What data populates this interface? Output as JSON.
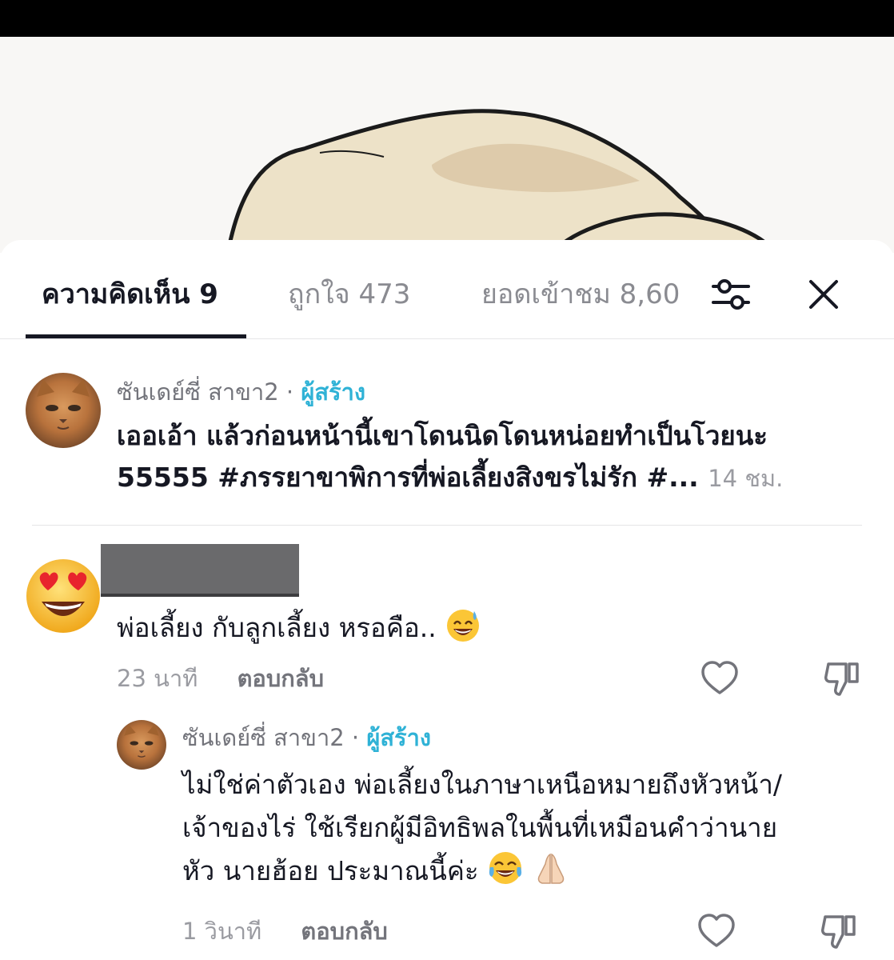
{
  "tabs": {
    "comments": "ความคิดเห็น 9",
    "likes": "ถูกใจ 473",
    "views": "ยอดเข้าชม 8,60"
  },
  "icons": {
    "filter": "sliders-icon",
    "close": "close-icon",
    "like": "heart-icon",
    "dislike": "thumbs-down-icon"
  },
  "comments": [
    {
      "author": "ซันเดย์ซี่ สาขา2",
      "separator": "·",
      "badge": "ผู้สร้าง",
      "line1": "เออเอ้า แล้วก่อนหน้านี้เขาโดนนิดโดนหน่อยทำเป็นโวยนะ",
      "line2": "55555 #ภรรยาขาพิการที่พ่อเลี้ยงสิงขรไม่รัก #...",
      "time": "14 ชม."
    },
    {
      "text": "พ่อเลี้ยง กับลูกเลี้ยง หรอคือ..",
      "time": "23 นาที",
      "reply": "ตอบกลับ",
      "reply_item": {
        "author": "ซันเดย์ซี่ สาขา2",
        "separator": "·",
        "badge": "ผู้สร้าง",
        "line1": "ไม่ใช่ค่าตัวเอง พ่อเลี้ยงในภาษาเหนือหมายถึงหัวหน้า/",
        "line2": "เจ้าของไร่ ใช้เรียกผู้มีอิทธิพลในพื้นที่เหมือนคำว่านาย",
        "line3": "หัว นายฮ้อย ประมาณนี้ค่ะ",
        "time": "1 วินาที",
        "reply": "ตอบกลับ"
      }
    }
  ],
  "colors": {
    "creator_badge": "#2fb2d6",
    "text": "#161823",
    "muted": "#9a9ba1"
  }
}
